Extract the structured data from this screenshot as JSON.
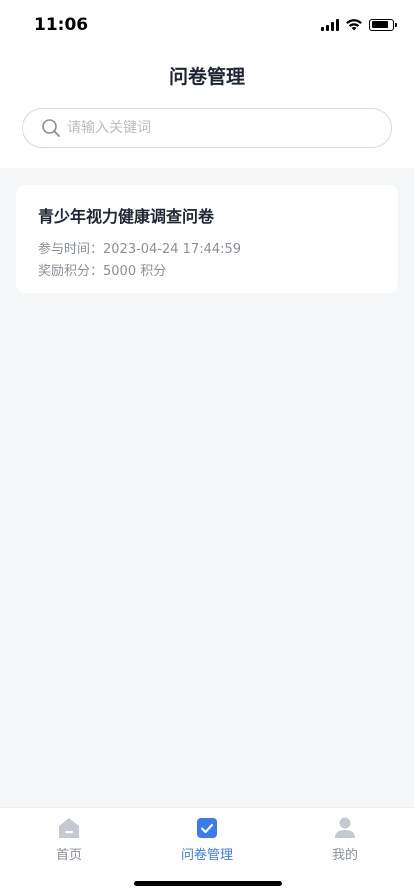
{
  "status_bar": {
    "time": "11:06"
  },
  "header": {
    "title": "问卷管理"
  },
  "search": {
    "placeholder": "请输入关键词",
    "value": ""
  },
  "surveys": [
    {
      "title": "青少年视力健康调查问卷",
      "participation": "参与时间：2023-04-24 17:44:59",
      "reward": "奖励积分：5000 积分"
    }
  ],
  "tabs": [
    {
      "label": "首页",
      "icon": "home-icon",
      "active": false
    },
    {
      "label": "问卷管理",
      "icon": "checkbox-icon",
      "active": true
    },
    {
      "label": "我的",
      "icon": "user-icon",
      "active": false
    }
  ],
  "colors": {
    "accent": "#3a7bf0",
    "inactive": "#8a8f99",
    "background": "#f5f6f8"
  }
}
